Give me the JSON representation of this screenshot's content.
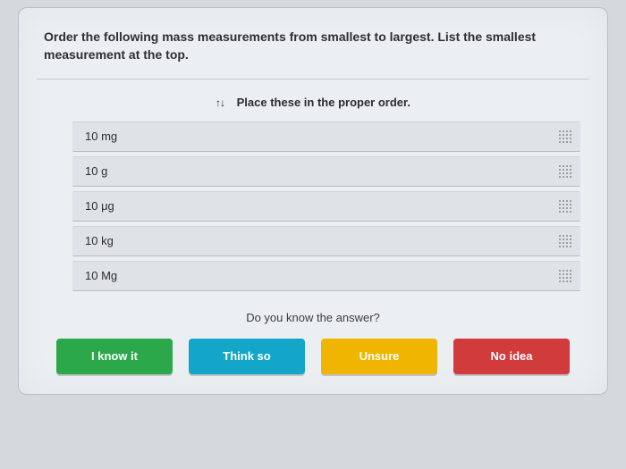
{
  "question": "Order the following mass measurements from smallest to largest. List the smallest measurement at the top.",
  "instruction": "Place these in the proper order.",
  "items": [
    {
      "label": "10 mg"
    },
    {
      "label": "10 g"
    },
    {
      "label": "10 μg"
    },
    {
      "label": "10 kg"
    },
    {
      "label": "10 Mg"
    }
  ],
  "confirm_prompt": "Do you know the answer?",
  "buttons": {
    "know": "I know it",
    "think": "Think so",
    "unsure": "Unsure",
    "noidea": "No idea"
  }
}
